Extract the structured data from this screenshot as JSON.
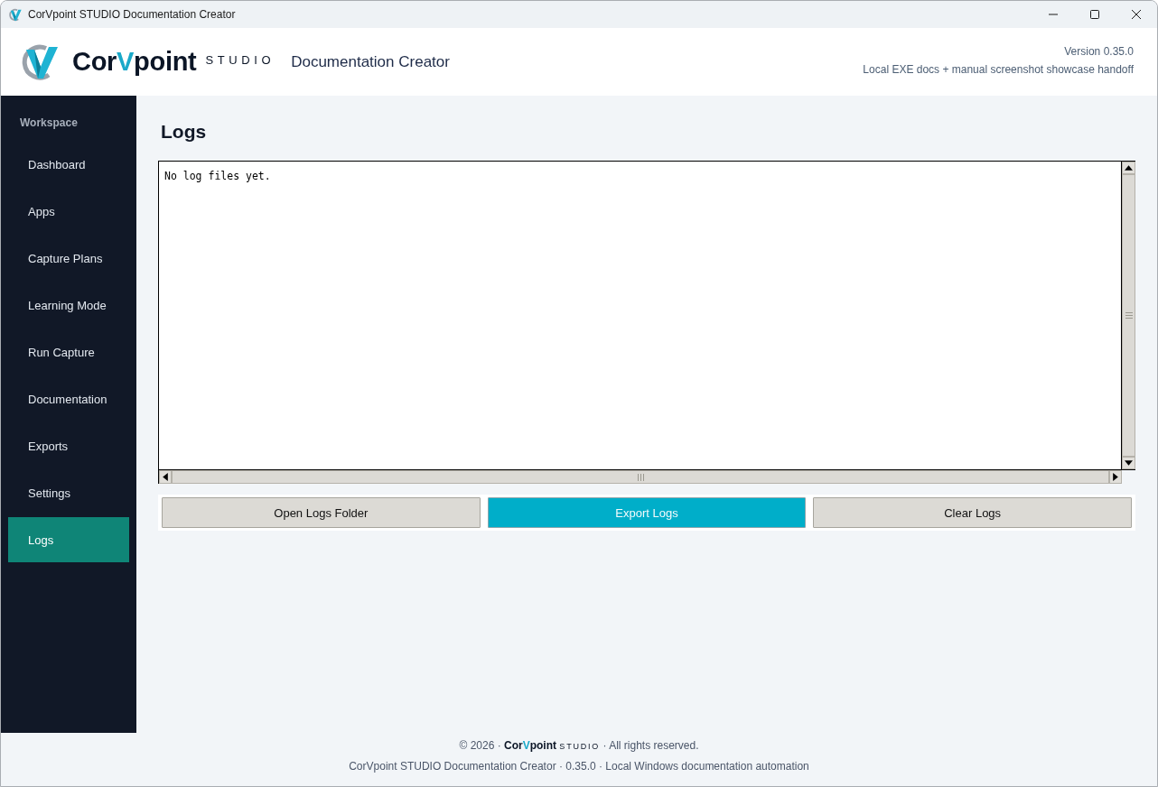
{
  "window": {
    "title": "CorVpoint STUDIO Documentation Creator"
  },
  "header": {
    "brand": {
      "wordmark": [
        {
          "text": "Cor",
          "accent": false
        },
        {
          "text": "V",
          "accent": true
        },
        {
          "text": "point",
          "accent": false
        }
      ],
      "suffix": "STUDIO"
    },
    "app_name": "Documentation Creator",
    "version": "Version 0.35.0",
    "tagline": "Local EXE docs + manual screenshot showcase handoff"
  },
  "sidebar": {
    "section": "Workspace",
    "items": [
      {
        "label": "Dashboard",
        "selected": false
      },
      {
        "label": "Apps",
        "selected": false
      },
      {
        "label": "Capture Plans",
        "selected": false
      },
      {
        "label": "Learning Mode",
        "selected": false
      },
      {
        "label": "Run Capture",
        "selected": false
      },
      {
        "label": "Documentation",
        "selected": false
      },
      {
        "label": "Exports",
        "selected": false
      },
      {
        "label": "Settings",
        "selected": false
      },
      {
        "label": "Logs",
        "selected": true
      }
    ]
  },
  "page": {
    "title": "Logs",
    "log_text": "No log files yet.",
    "buttons": [
      {
        "label": "Open Logs Folder",
        "kind": "secondary"
      },
      {
        "label": "Export Logs",
        "kind": "primary"
      },
      {
        "label": "Clear Logs",
        "kind": "secondary"
      }
    ]
  },
  "footer": {
    "copyright": {
      "before": "© 2026 ·",
      "brand": {
        "wordmark": [
          {
            "text": "Cor",
            "accent": false
          },
          {
            "text": "V",
            "accent": true
          },
          {
            "text": "point",
            "accent": false
          }
        ],
        "suffix": "STUDIO"
      },
      "after": "· All rights reserved."
    },
    "info": "CorVpoint STUDIO Documentation Creator · 0.35.0 · Local Windows documentation automation"
  }
}
